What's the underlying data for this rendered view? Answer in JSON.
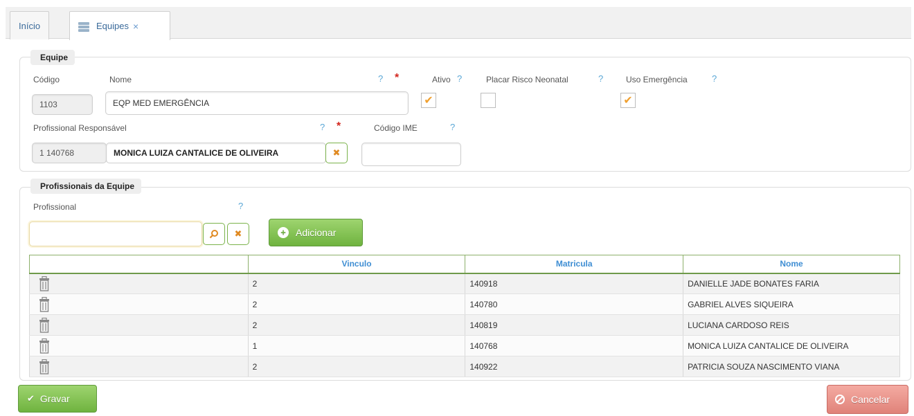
{
  "tabs": [
    {
      "label": "Início",
      "active": false
    },
    {
      "label": "Equipes",
      "active": true,
      "close": "×"
    }
  ],
  "equipe": {
    "legend": "Equipe",
    "codigo_label": "Código",
    "codigo_value": "1103",
    "nome_label": "Nome",
    "nome_value": "EQP MED EMERGÊNCIA",
    "ativo_label": "Ativo",
    "ativo_checked": true,
    "placar_label": "Placar Risco Neonatal",
    "placar_checked": false,
    "uso_label": "Uso Emergência",
    "uso_checked": true,
    "prof_resp_label": "Profissional Responsável",
    "prof_resp_code": "1 140768",
    "prof_resp_name": "MONICA LUIZA CANTALICE DE OLIVEIRA",
    "codigo_ime_label": "Código IME",
    "codigo_ime_value": "",
    "help": "?",
    "required": "*"
  },
  "profissionais": {
    "legend": "Profissionais da Equipe",
    "profissional_label": "Profissional",
    "profissional_value": "",
    "add_label": "Adicionar",
    "columns": [
      "",
      "Vinculo",
      "Matricula",
      "Nome"
    ],
    "rows": [
      {
        "vinculo": "2",
        "matricula": "140918",
        "nome": "DANIELLE JADE BONATES FARIA"
      },
      {
        "vinculo": "2",
        "matricula": "140780",
        "nome": "GABRIEL ALVES SIQUEIRA"
      },
      {
        "vinculo": "2",
        "matricula": "140819",
        "nome": "LUCIANA CARDOSO REIS"
      },
      {
        "vinculo": "1",
        "matricula": "140768",
        "nome": "MONICA LUIZA CANTALICE DE OLIVEIRA"
      },
      {
        "vinculo": "2",
        "matricula": "140922",
        "nome": "PATRICIA SOUZA NASCIMENTO VIANA"
      }
    ]
  },
  "actions": {
    "gravar": "Gravar",
    "cancelar": "Cancelar"
  },
  "colors": {
    "accent_green": "#6fb33f",
    "cancel_red": "#e0837a",
    "link_blue": "#3f8ed3",
    "check_orange": "#f0a030",
    "required_red": "#d3271f"
  }
}
